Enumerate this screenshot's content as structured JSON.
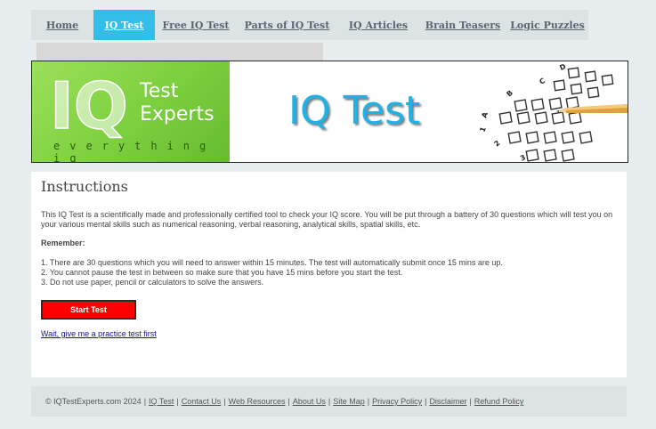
{
  "nav": {
    "items": [
      {
        "label": "Home",
        "active": false
      },
      {
        "label": "IQ Test",
        "active": true
      },
      {
        "label": "Free IQ Test",
        "active": false
      },
      {
        "label": "Parts of IQ Test",
        "active": false
      },
      {
        "label": "IQ Articles",
        "active": false
      },
      {
        "label": "Brain Teasers",
        "active": false
      },
      {
        "label": "Logic Puzzles",
        "active": false
      }
    ]
  },
  "banner": {
    "logo": {
      "mark": "IQ",
      "line1": "Test",
      "line2": "Experts",
      "tagline": "everything iq"
    },
    "title": "IQ Test",
    "answer_letters": [
      "A",
      "B",
      "C",
      "D"
    ],
    "answer_numbers": [
      "1",
      "2",
      "3"
    ]
  },
  "content": {
    "heading": "Instructions",
    "intro": "This IQ Test is a scientifically made and professionally certified tool to check your IQ score. You will be put through a battery of 30 questions which will test you on your various mental skills such as numerical reasoning, verbal reasoning, analytical skills, spatial skills, etc.",
    "remember_label": "Remember:",
    "rules": [
      "1. There are 30 questions which you will need to answer within 15 minutes. The test will automatically submit once 15 mins are up.",
      "2. You cannot pause the test in between so make sure that you have 15 mins before you start the test.",
      "3. Do not use paper, pencil or calculators to solve the answers."
    ],
    "start_button": "Start Test",
    "practice_link": "Wait, give me a practice test first"
  },
  "footer": {
    "copyright": "© IQTestExperts.com 2024",
    "links": [
      "IQ Test",
      "Contact Us",
      "Web Resources",
      "About Us",
      "Site Map",
      "Privacy Policy",
      "Disclaimer",
      "Refund Policy"
    ]
  },
  "colors": {
    "nav_active": "#33bde9",
    "start_button": "#ff0000",
    "logo_green": "#7ccf3e",
    "banner_title": "#22b1e4"
  }
}
